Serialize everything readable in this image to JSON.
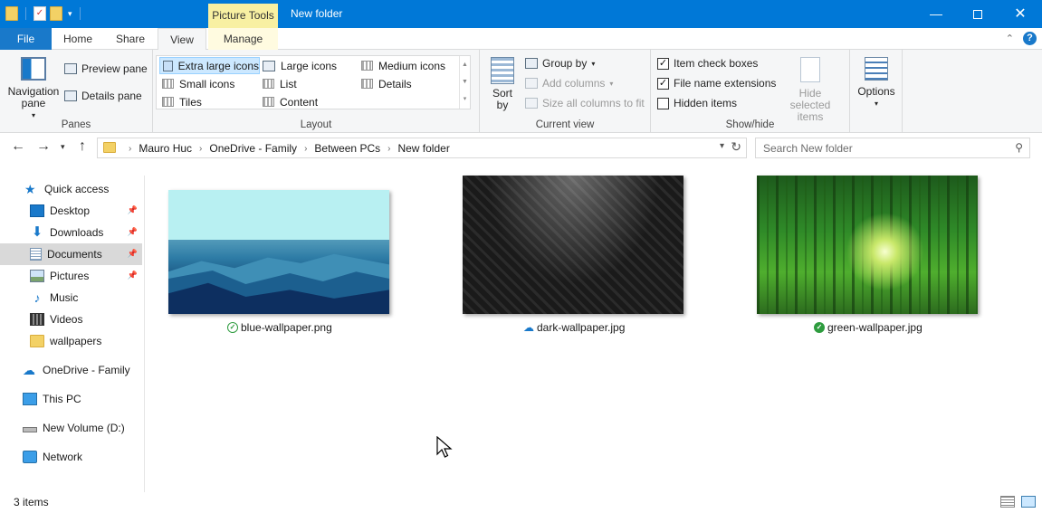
{
  "window": {
    "title": "New folder",
    "context_tab": "Picture Tools",
    "minimize": "—",
    "close": "✕"
  },
  "tabs": {
    "file": "File",
    "home": "Home",
    "share": "Share",
    "view": "View",
    "manage": "Manage"
  },
  "ribbon": {
    "panes": {
      "label": "Panes",
      "navigation_pane": "Navigation pane",
      "preview_pane": "Preview pane",
      "details_pane": "Details pane"
    },
    "layout": {
      "label": "Layout",
      "items": [
        "Extra large icons",
        "Large icons",
        "Medium icons",
        "Small icons",
        "List",
        "Details",
        "Tiles",
        "Content"
      ],
      "selected": "Extra large icons"
    },
    "current_view": {
      "label": "Current view",
      "sort_by": "Sort by",
      "group_by": "Group by",
      "add_columns": "Add columns",
      "size_all_columns": "Size all columns to fit"
    },
    "show_hide": {
      "label": "Show/hide",
      "item_check_boxes": "Item check boxes",
      "item_check_boxes_checked": true,
      "file_name_extensions": "File name extensions",
      "file_name_extensions_checked": true,
      "hidden_items": "Hidden items",
      "hidden_items_checked": false,
      "hide_selected_items": "Hide selected items"
    },
    "options": "Options"
  },
  "address": {
    "crumbs": [
      "Mauro Huc",
      "OneDrive - Family",
      "Between PCs",
      "New folder"
    ]
  },
  "search": {
    "placeholder": "Search New folder"
  },
  "nav_pane": {
    "items": [
      {
        "label": "Quick access",
        "icon": "star-icon"
      },
      {
        "label": "Desktop",
        "icon": "desktop-icon",
        "pinned": true
      },
      {
        "label": "Downloads",
        "icon": "download-icon",
        "pinned": true
      },
      {
        "label": "Documents",
        "icon": "documents-icon",
        "pinned": true,
        "selected": true
      },
      {
        "label": "Pictures",
        "icon": "pictures-icon",
        "pinned": true
      },
      {
        "label": "Music",
        "icon": "music-icon"
      },
      {
        "label": "Videos",
        "icon": "videos-icon"
      },
      {
        "label": "wallpapers",
        "icon": "folder-icon"
      },
      {
        "label": "OneDrive - Family",
        "icon": "cloud-icon"
      },
      {
        "label": "This PC",
        "icon": "computer-icon"
      },
      {
        "label": "New Volume (D:)",
        "icon": "drive-icon"
      },
      {
        "label": "Network",
        "icon": "network-icon"
      }
    ]
  },
  "files": [
    {
      "name": "blue-wallpaper.png",
      "status": "available-locally"
    },
    {
      "name": "dark-wallpaper.jpg",
      "status": "online-only"
    },
    {
      "name": "green-wallpaper.jpg",
      "status": "always-available"
    }
  ],
  "status": {
    "item_count": "3 items"
  },
  "colors": {
    "accent": "#0078d7",
    "file_tab": "#1979ca",
    "context_tab": "#f8f0a2",
    "selection": "#cce8ff",
    "sync_ok": "#2e9c3f"
  }
}
